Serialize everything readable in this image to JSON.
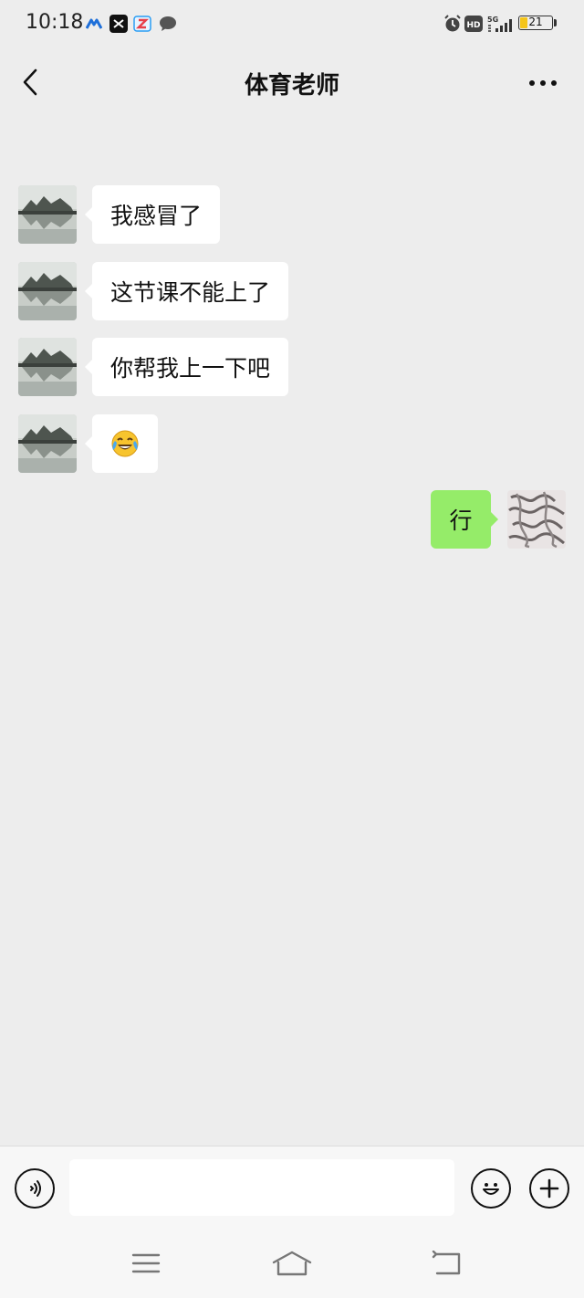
{
  "status_bar": {
    "time": "10:18",
    "network": "5G",
    "battery": "21",
    "battery_level": 0.21,
    "hd": "HD",
    "notification_icons": [
      "app-icon",
      "capcut-icon",
      "app-icon",
      "chat-icon"
    ],
    "system_icons": [
      "alarm-icon",
      "hd-icon",
      "signal-icon",
      "battery-icon"
    ]
  },
  "header": {
    "title": "体育老师",
    "back_icon": "chevron-left-icon",
    "more_icon": "more-icon"
  },
  "messages": [
    {
      "sender": "other",
      "text": "我感冒了"
    },
    {
      "sender": "other",
      "text": "这节课不能上了"
    },
    {
      "sender": "other",
      "text": "你帮我上一下吧"
    },
    {
      "sender": "other",
      "text": "😂"
    },
    {
      "sender": "me",
      "text": "行"
    }
  ],
  "input_bar": {
    "value": "",
    "voice_icon": "voice-icon",
    "emoji_icon": "emoji-icon",
    "plus_icon": "plus-icon"
  },
  "nav_bar": {
    "icons": [
      "menu-icon",
      "home-icon",
      "back-icon"
    ]
  },
  "colors": {
    "background": "#ededed",
    "outgoing_bubble": "#95ec69",
    "incoming_bubble": "#ffffff",
    "battery": "#f5c518"
  }
}
